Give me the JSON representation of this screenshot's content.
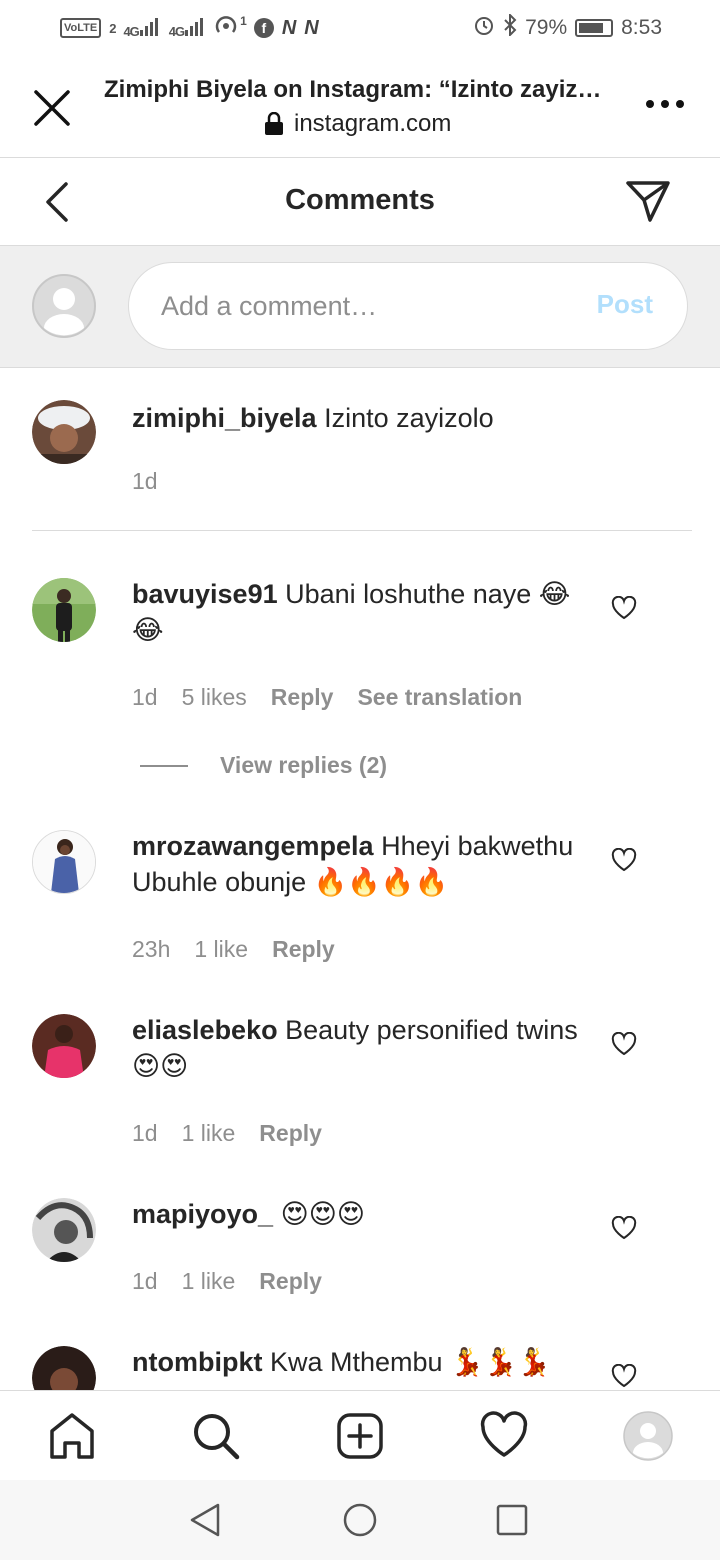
{
  "status_bar": {
    "volte": "VoLTE",
    "sim": "2",
    "signal1": "4G",
    "signal2": "4G",
    "hotspot_count": "1",
    "battery_percent": "79%",
    "time": "8:53"
  },
  "browser": {
    "title": "Zimiphi Biyela on Instagram: “Izinto zayizolo”",
    "url": "instagram.com"
  },
  "header": {
    "title": "Comments"
  },
  "add_comment": {
    "placeholder": "Add a comment…",
    "post_label": "Post"
  },
  "caption": {
    "username": "zimiphi_biyela",
    "text": "Izinto zayizolo",
    "time": "1d"
  },
  "comments": [
    {
      "username": "bavuyise91",
      "text": "Ubani loshuthe naye 😂😂",
      "time": "1d",
      "likes": "5 likes",
      "reply": "Reply",
      "translate": "See translation"
    },
    {
      "username": "mrozawangempela",
      "text": "Hheyi bakwethu Ubuhle obunje 🔥🔥🔥🔥",
      "time": "23h",
      "likes": "1 like",
      "reply": "Reply"
    },
    {
      "username": "eliaslebeko",
      "text": "Beauty personified twins😍😍",
      "time": "1d",
      "likes": "1 like",
      "reply": "Reply"
    },
    {
      "username": "mapiyoyo_",
      "text": "😍😍😍",
      "time": "1d",
      "likes": "1 like",
      "reply": "Reply"
    },
    {
      "username": "ntombipkt",
      "text": "Kwa Mthembu 💃💃💃"
    }
  ],
  "view_replies": "View replies (2)",
  "colors": {
    "primary_text": "#262626",
    "secondary_text": "#8e8e8e",
    "post_disabled": "#b2dffc",
    "divider": "#dbdbdb"
  }
}
